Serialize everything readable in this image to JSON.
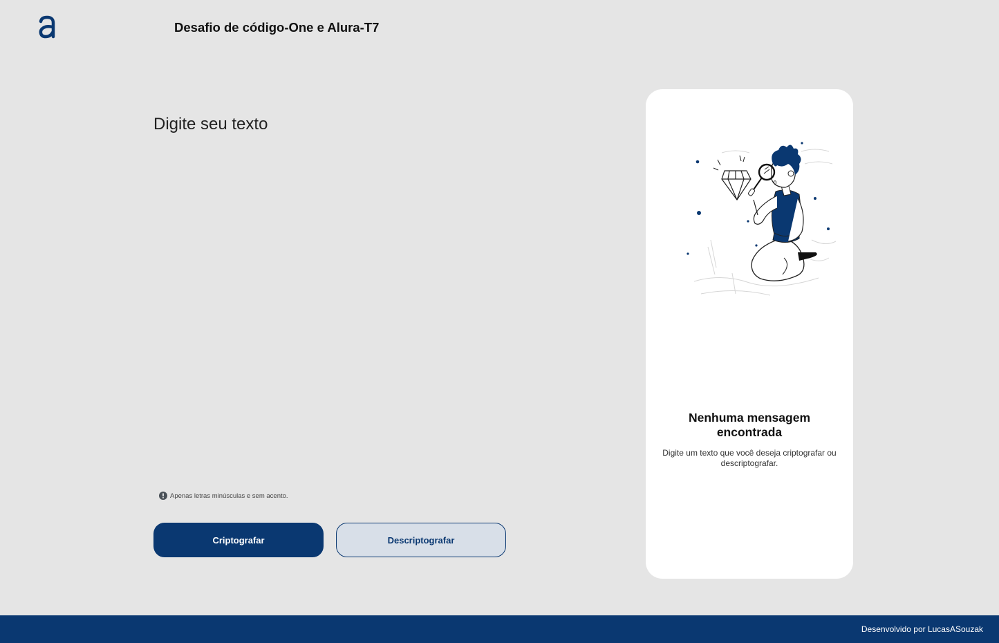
{
  "header": {
    "logo_icon": "alura-logo-icon",
    "title": "Desafio de código-One e Alura-T7"
  },
  "input": {
    "placeholder": "Digite seu texto",
    "value": ""
  },
  "hint": {
    "icon": "exclamation-circle-icon",
    "text": "Apenas letras minúsculas e sem acento."
  },
  "buttons": {
    "encrypt_label": "Criptografar",
    "decrypt_label": "Descriptografar"
  },
  "output": {
    "illustration": "person-with-magnifying-glass-illustration",
    "empty_title": "Nenhuma mensagem encontrada",
    "empty_description": "Digite um texto que você deseja criptografar ou descriptografar."
  },
  "footer": {
    "credit": "Desenvolvido por LucasASouzak"
  },
  "colors": {
    "background": "#e5e5e5",
    "primary": "#0a3871",
    "secondary_button_bg": "#d8dfe8",
    "card": "#ffffff"
  }
}
